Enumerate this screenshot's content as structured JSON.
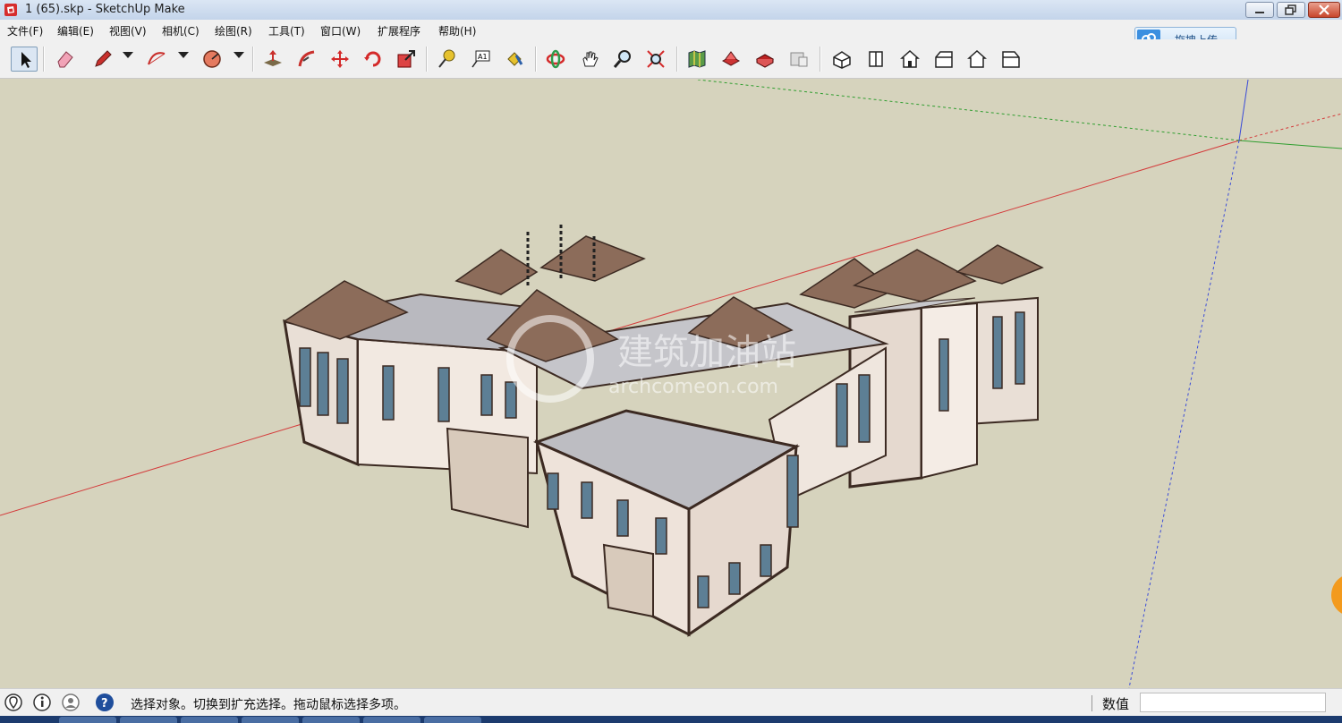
{
  "window": {
    "title": "1 (65).skp - SketchUp Make",
    "app_icon": "sketchup-logo-icon",
    "controls": [
      "minimize-icon",
      "restore-icon",
      "close-icon"
    ]
  },
  "menu": [
    {
      "label": "文件(F)"
    },
    {
      "label": "编辑(E)"
    },
    {
      "label": "视图(V)"
    },
    {
      "label": "相机(C)"
    },
    {
      "label": "绘图(R)"
    },
    {
      "label": "工具(T)"
    },
    {
      "label": "窗口(W)"
    },
    {
      "label": "扩展程序"
    },
    {
      "label": "帮助(H)"
    }
  ],
  "upload_button": {
    "label": "拖拽上传",
    "icon": "cloud-upload-icon"
  },
  "toolbar": {
    "tools": [
      "select-icon",
      "eraser-icon",
      "pencil-icon",
      "arc-icon",
      "polygon-icon",
      "push-pull-icon",
      "follow-me-icon",
      "move-icon",
      "rotate-icon",
      "scale-icon",
      "tape-measure-icon",
      "text-icon",
      "paint-bucket-icon",
      "orbit-icon",
      "pan-icon",
      "zoom-icon",
      "zoom-extents-icon",
      "get-models-icon",
      "share-model-icon",
      "extension-warehouse-icon",
      "send-to-layout-icon",
      "iso-view-icon",
      "top-view-icon",
      "front-view-icon",
      "right-view-icon",
      "back-view-icon",
      "left-view-icon"
    ]
  },
  "viewport": {
    "watermark": {
      "text_cn": "建筑加油站",
      "text_en": "archcomeon.com"
    },
    "axis_colors": {
      "red": "#d43c3c",
      "green": "#2f9e2f",
      "blue": "#3a4bd8"
    },
    "background": "#d6d3bd"
  },
  "status": {
    "message": "选择对象。切换到扩充选择。拖动鼠标选择多项。",
    "measurements_label": "数值",
    "measurements_value": "",
    "icons": [
      "geo-location-icon",
      "credits-icon",
      "user-icon",
      "help-icon"
    ]
  }
}
